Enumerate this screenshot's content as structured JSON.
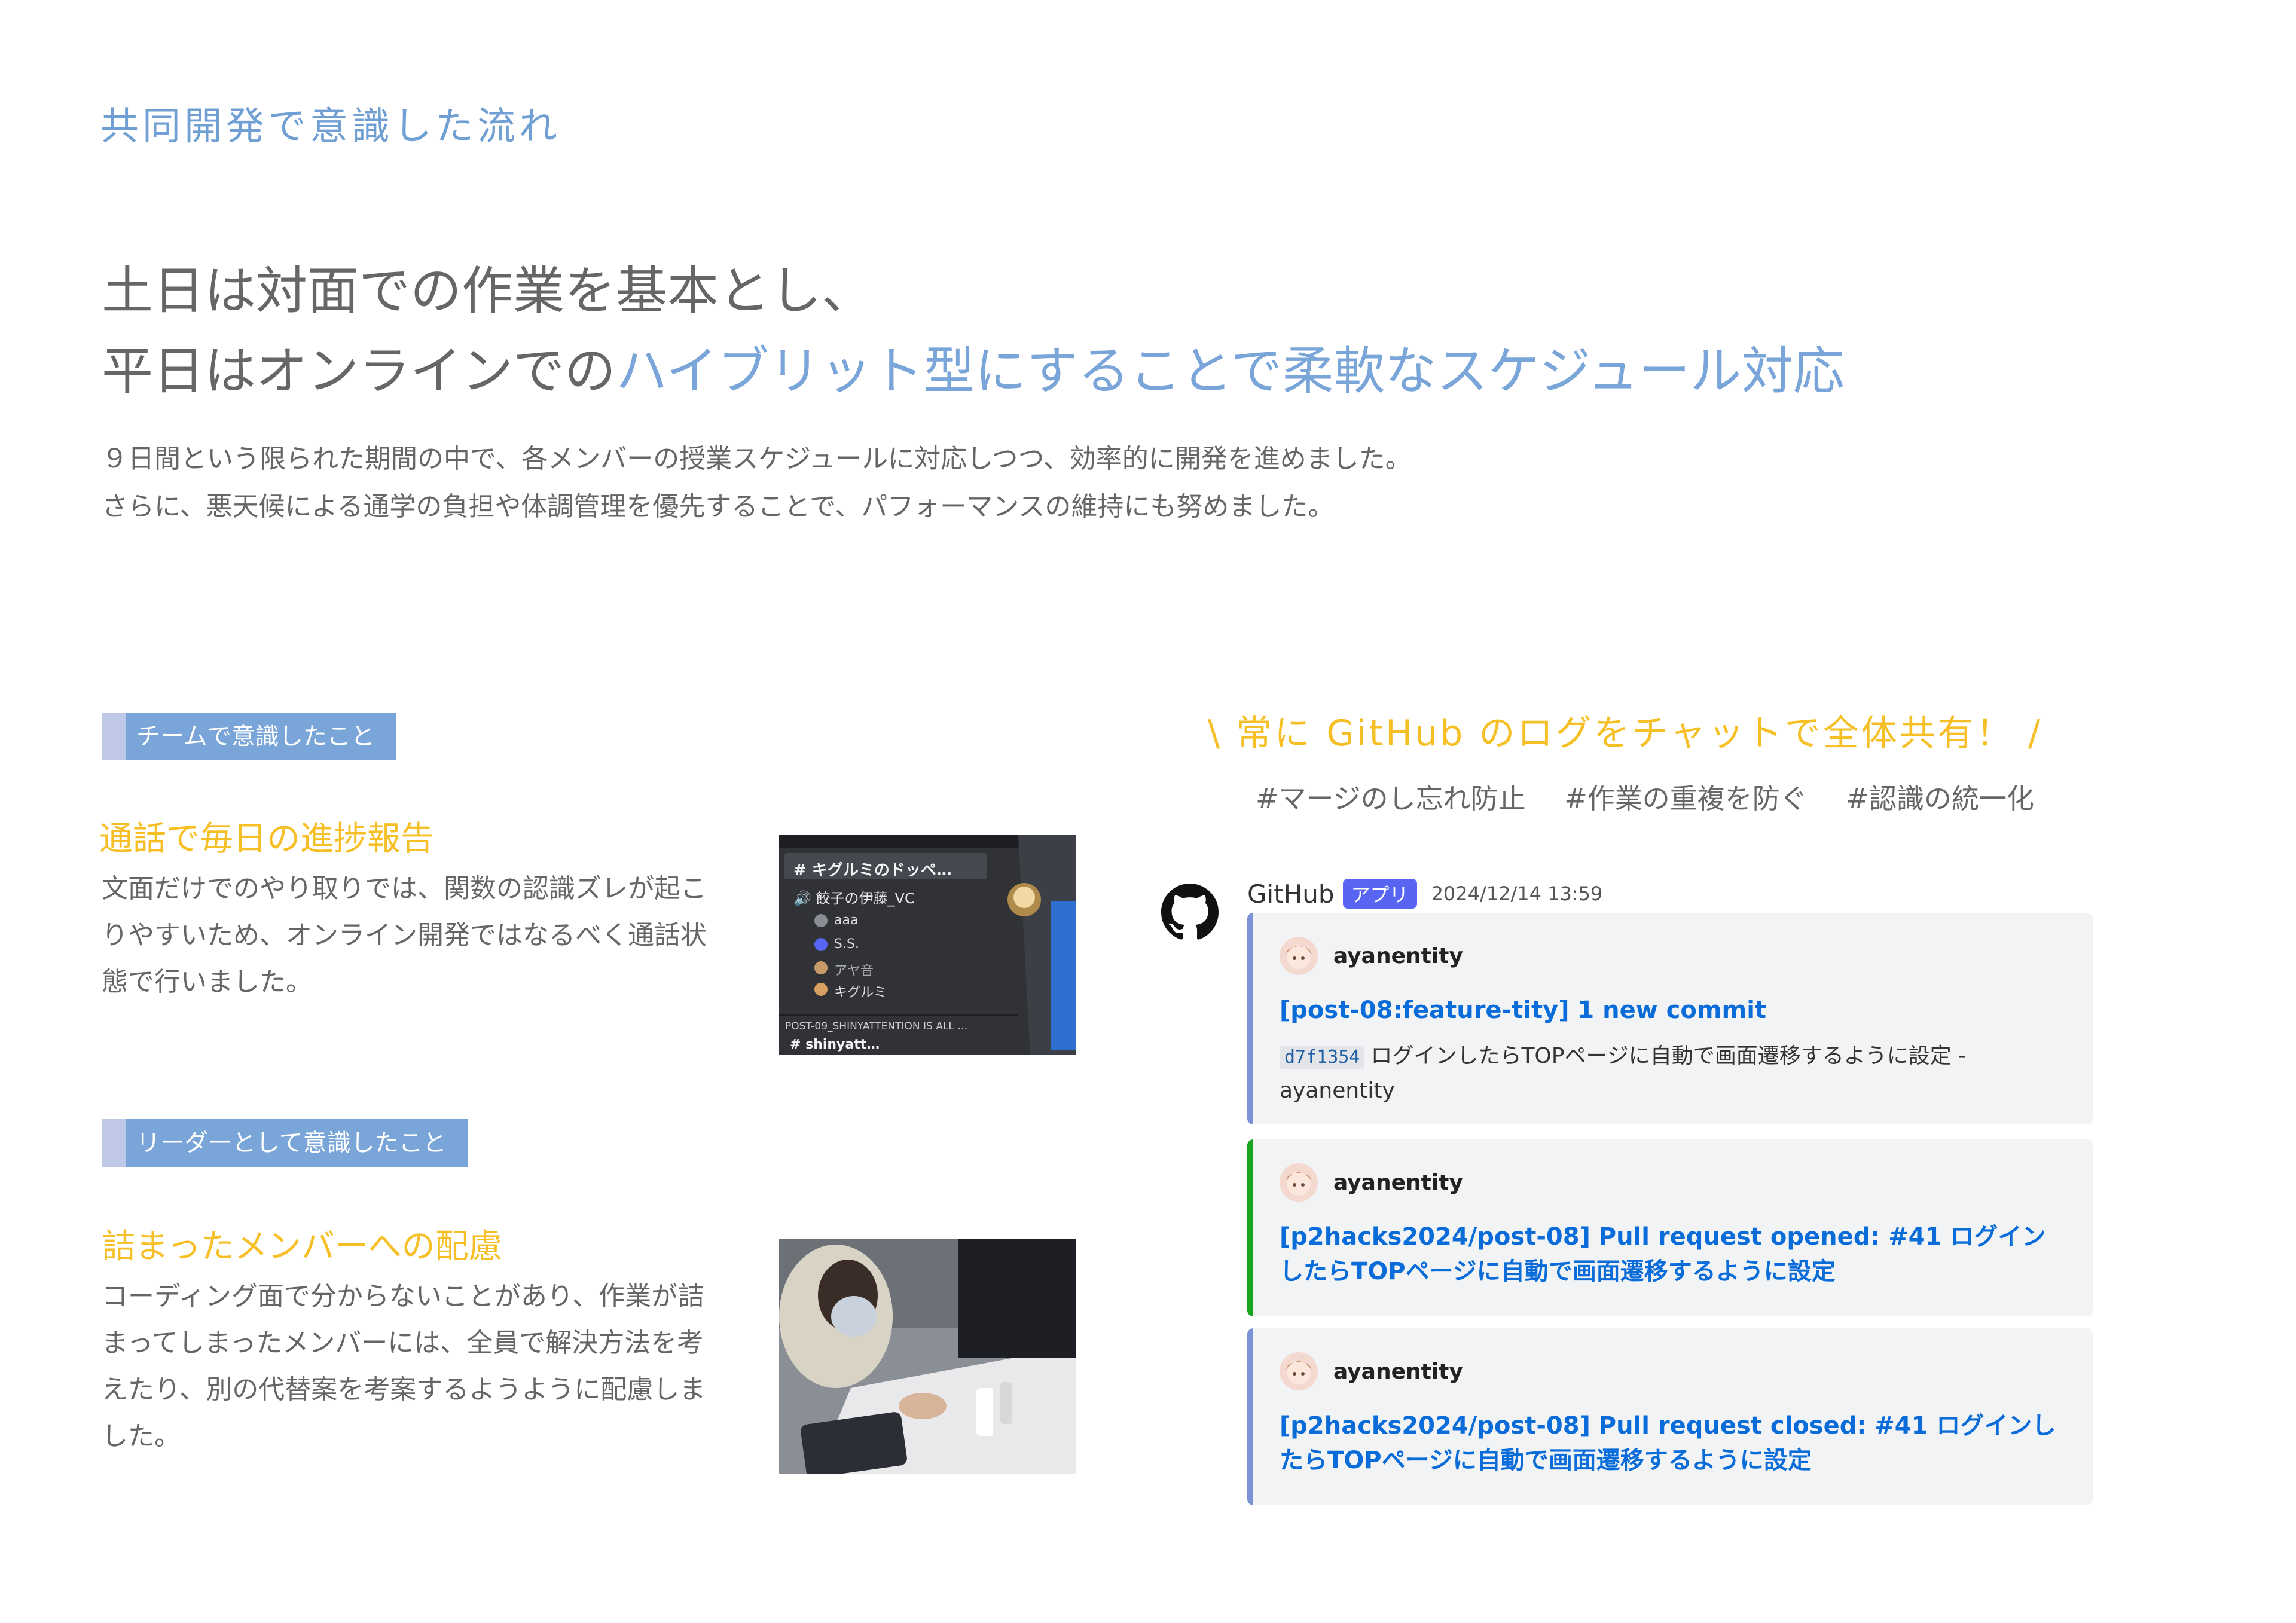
{
  "section_label": "共同開発で意識した流れ",
  "headline": {
    "line1": "土日は対面での作業を基本とし、",
    "line2_plain": "平日はオンラインでの",
    "line2_accent": "ハイブリット型にすることで柔軟なスケジュール対応"
  },
  "lead": {
    "line1": "９日間という限られた期間の中で、各メンバーの授業スケジュールに対応しつつ、効率的に開発を進めました。",
    "line2": "さらに、悪天候による通学の負担や体調管理を優先することで、パフォーマンスの維持にも努めました。"
  },
  "team": {
    "tag": "チームで意識したこと",
    "heading": "通話で毎日の進捗報告",
    "body": "文面だけでのやり取りでは、関数の認識ズレが起こりやすいため、オンライン開発ではなるべく通話状態で行いました。",
    "screenshot": {
      "channel_top": "# キグルミのドッペ…",
      "voice_channel": "餃子の伊藤_VC",
      "members": [
        "aaa",
        "S.S.",
        "アヤ音",
        "キグルミ"
      ],
      "footer": "POST-09_SHINYATTENTION IS ALL …",
      "channel_bottom": "# shinyatt…"
    }
  },
  "leader": {
    "tag": "リーダーとして意識したこと",
    "heading": "詰まったメンバーへの配慮",
    "body": "コーディング面で分からないことがあり、作業が詰まってしまったメンバーには、全員で解決方法を考えたり、別の代替案を考案するようように配慮しました。"
  },
  "callout": {
    "text": "\\ 常に GitHub のログをチャットで全体共有！ /",
    "tags": [
      "#マージのし忘れ防止",
      "#作業の重複を防ぐ",
      "#認識の統一化"
    ]
  },
  "chat": {
    "sender": "GitHub",
    "badge": "アプリ",
    "timestamp": "2024/12/14 13:59",
    "embeds": [
      {
        "author": "ayanentity",
        "title": "[post-08:feature-tity] 1 new commit",
        "hash": "d7f1354",
        "desc": "ログインしたらTOPページに自動で画面遷移するように設定 - ayanentity",
        "color": "#7a93d6"
      },
      {
        "author": "ayanentity",
        "title": "[p2hacks2024/post-08] Pull request opened: #41 ログインしたらTOPページに自動で画面遷移するように設定",
        "color": "#17a51e"
      },
      {
        "author": "ayanentity",
        "title": "[p2hacks2024/post-08] Pull request closed: #41 ログインしたらTOPページに自動で画面遷移するように設定",
        "color": "#7a93d6"
      }
    ]
  },
  "colors": {
    "accent_blue": "#79a5d8",
    "accent_yellow": "#f6bf26",
    "link_blue": "#0a6cd8",
    "discord_badge": "#5865f2"
  }
}
